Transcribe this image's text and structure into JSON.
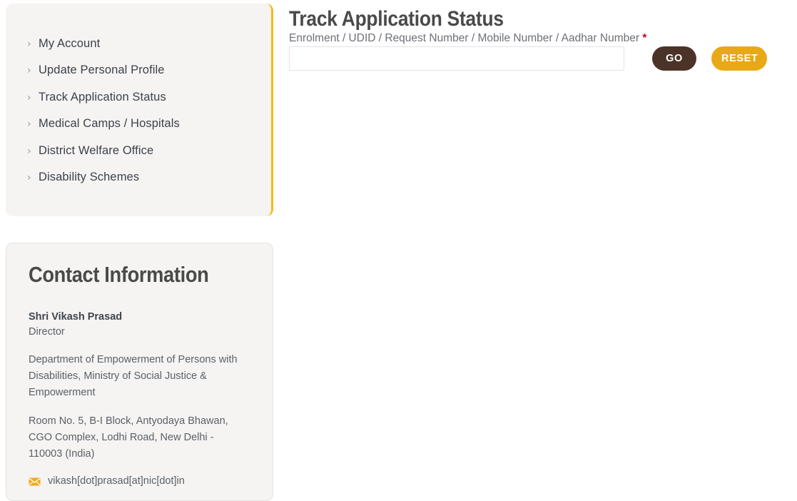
{
  "sidebar": {
    "chevron_glyph": "›",
    "items": [
      {
        "label": "My Account"
      },
      {
        "label": "Update Personal Profile"
      },
      {
        "label": "Track Application Status"
      },
      {
        "label": "Medical Camps / Hospitals"
      },
      {
        "label": "District Welfare Office"
      },
      {
        "label": "Disability Schemes"
      }
    ]
  },
  "contact": {
    "heading": "Contact Information",
    "name": "Shri Vikash Prasad",
    "role": "Director",
    "department": "Department of Empowerment of Persons with Disabilities, Ministry of Social Justice & Empowerment",
    "address": "Room No. 5, B-I Block, Antyodaya Bhawan, CGO Complex, Lodhi Road, New Delhi - 110003 (India)",
    "email": "vikash[dot]prasad[at]nic[dot]in",
    "email_icon": "envelope-icon"
  },
  "main": {
    "title": "Track Application Status",
    "field_label": "Enrolment / UDID / Request Number / Mobile Number / Aadhar Number",
    "required_marker": "*",
    "input_value": "",
    "input_placeholder": "",
    "go_label": "GO",
    "reset_label": "RESET"
  },
  "colors": {
    "accent_yellow": "#f6b917",
    "button_brown": "#4b3328",
    "button_amber": "#e9a818",
    "panel_bg": "#f5f4f2",
    "text_dark": "#3c414c",
    "text_muted": "#5a5f68",
    "required_red": "#d0021b"
  }
}
